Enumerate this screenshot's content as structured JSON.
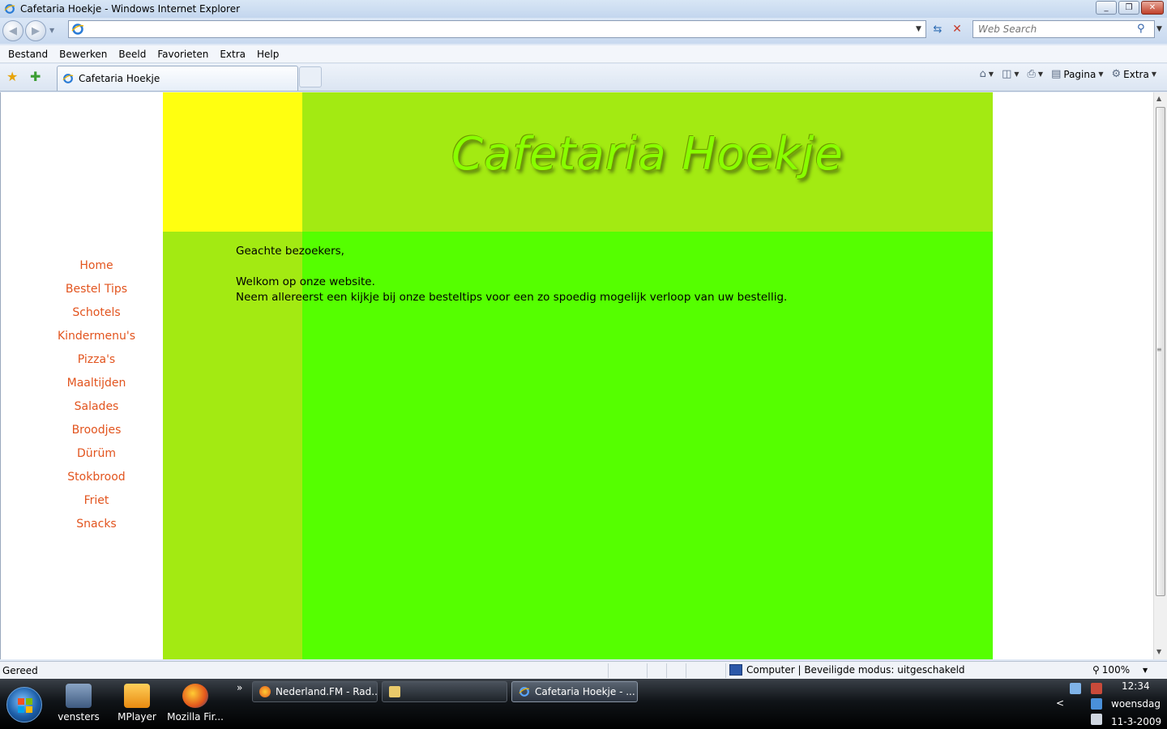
{
  "window": {
    "title": "Cafetaria Hoekje - Windows Internet Explorer",
    "minimize": "_",
    "maximize": "❐",
    "close": "✕"
  },
  "addressbar": {
    "url": "",
    "search_placeholder": "Web Search"
  },
  "menubar": {
    "items": [
      "Bestand",
      "Bewerken",
      "Beeld",
      "Favorieten",
      "Extra",
      "Help"
    ]
  },
  "tabs": {
    "active_title": "Cafetaria Hoekje"
  },
  "commandbar": {
    "page_label": "Pagina",
    "tools_label": "Extra"
  },
  "site": {
    "title": "Cafetaria Hoekje",
    "nav": [
      "Home",
      "Bestel Tips",
      "Schotels",
      "Kindermenu's",
      "Pizza's",
      "Maaltijden",
      "Salades",
      "Broodjes",
      "Dürüm",
      "Stokbrood",
      "Friet",
      "Snacks"
    ],
    "greeting": "Geachte bezoekers,",
    "welcome": "Welkom op onze website.",
    "intro": "Neem allereerst een kijkje bij onze besteltips voor een zo spoedig mogelijk verloop van uw bestellig.",
    "colors": {
      "yellow": "#ffff10",
      "header_green": "#a3ea12",
      "main_green": "#55ff00",
      "nav_link": "#e2541e"
    }
  },
  "statusbar": {
    "status": "Gereed",
    "zone": "Computer | Beveiligde modus: uitgeschakeld",
    "zoom": "100%"
  },
  "taskbar": {
    "quicklaunch": [
      "vensters",
      "MPlayer",
      "Mozilla Fir..."
    ],
    "buttons": [
      "Nederland.FM - Rad...",
      "",
      "Cafetaria Hoekje - ..."
    ],
    "clock": {
      "time": "12:34",
      "day": "woensdag",
      "date": "11-3-2009"
    }
  }
}
